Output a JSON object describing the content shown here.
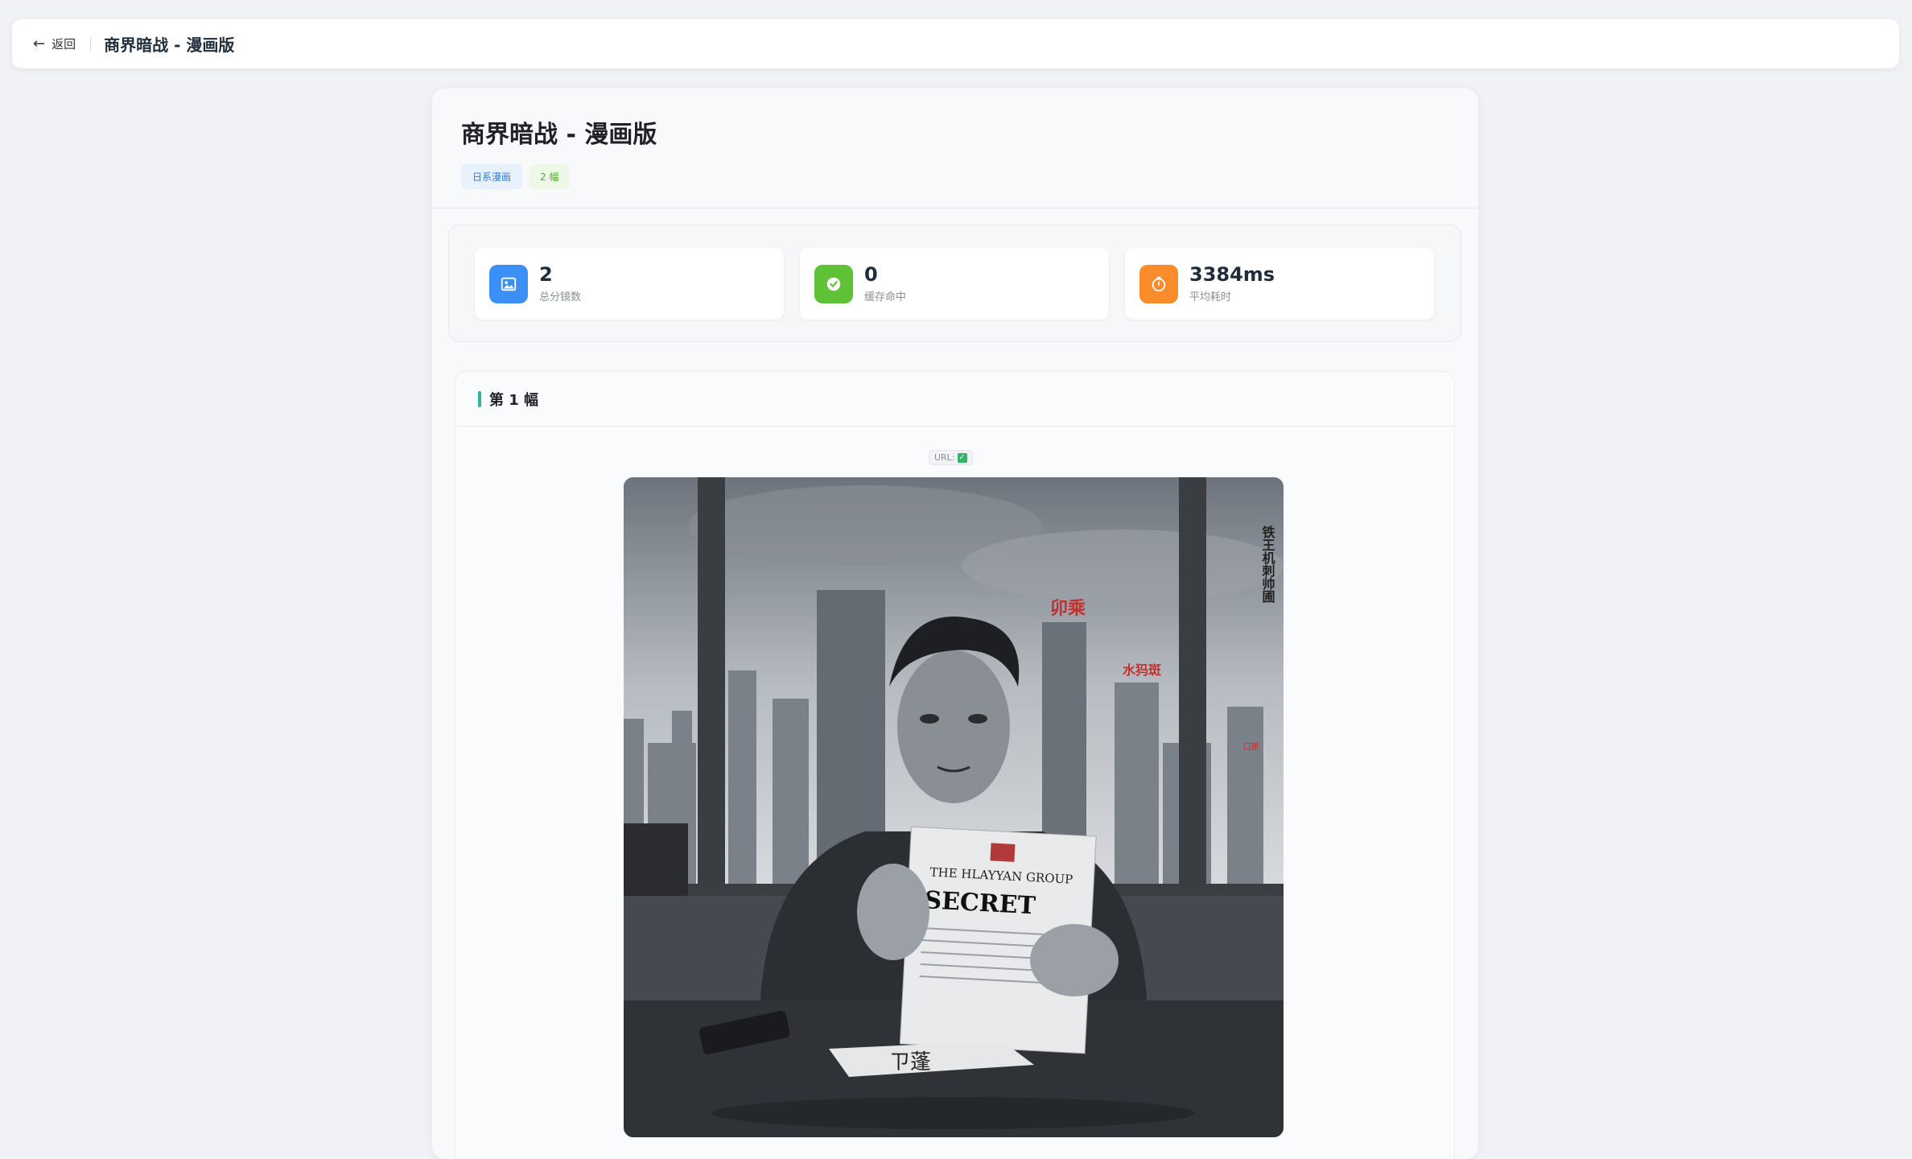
{
  "topbar": {
    "back_label": "返回",
    "title": "商界暗战 - 漫画版"
  },
  "header": {
    "title": "商界暗战 - 漫画版",
    "tags": {
      "style": "日系漫画",
      "count": "2 幅"
    }
  },
  "stats": [
    {
      "icon": "image-icon",
      "value": "2",
      "label": "总分镜数",
      "color": "#3b8ff6"
    },
    {
      "icon": "check-circle-icon",
      "value": "0",
      "label": "缓存命中",
      "color": "#5fc236"
    },
    {
      "icon": "timer-icon",
      "value": "3384ms",
      "label": "平均耗时",
      "color": "#fb8c2b"
    }
  ],
  "panel": {
    "title": "第 1 幅",
    "url_label": "URL:",
    "illustration": {
      "sign_big": "卯乘",
      "sign_small": "水犸斑",
      "sign_tiny": "口匣",
      "vertical_text": "铁王机刺帅圃",
      "doc_header": "THE HLAYYAN GROUP",
      "doc_title": "SECRET",
      "paper_text": "ㄗ蓬"
    }
  },
  "colors": {
    "accent_teal": "#2bb3a3",
    "tag_blue": "#2f7be4",
    "tag_green": "#56a935"
  }
}
